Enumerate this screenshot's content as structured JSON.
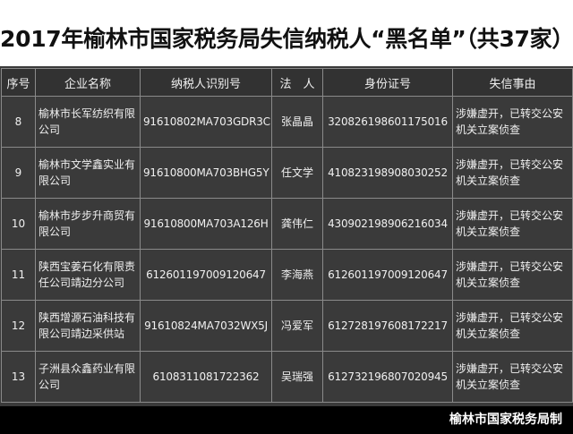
{
  "title": "2017年榆林市国家税务局失信纳税人“黑名单”（共37家）",
  "headers": [
    "序号",
    "企业名称",
    "纳税人识别号",
    "法　人",
    "身份证号",
    "失信事由"
  ],
  "rows": [
    {
      "no": "8",
      "name": "榆林市长军纺织有限公司",
      "tax_id": "91610802MA703GDR3C",
      "rep": "张晶晶",
      "id_no": "320826198601175016",
      "reason": "涉嫌虚开，已转交公安机关立案侦查"
    },
    {
      "no": "9",
      "name": "榆林市文学鑫实业有限公司",
      "tax_id": "91610800MA703BHG5Y",
      "rep": "任文学",
      "id_no": "410823198908030252",
      "reason": "涉嫌虚开，已转交公安机关立案侦查"
    },
    {
      "no": "10",
      "name": "榆林市步步升商贸有限公司",
      "tax_id": "91610800MA703A126H",
      "rep": "龚伟仁",
      "id_no": "430902198906216034",
      "reason": "涉嫌虚开，已转交公安机关立案侦查"
    },
    {
      "no": "11",
      "name": "陕西宝姜石化有限责任公司靖边分公司",
      "tax_id": "612601197009120647",
      "rep": "李海燕",
      "id_no": "612601197009120647",
      "reason": "涉嫌虚开，已转交公安机关立案侦查"
    },
    {
      "no": "12",
      "name": "陕西增源石油科技有限公司靖边采供站",
      "tax_id": "91610824MA7032WX5J",
      "rep": "冯爱军",
      "id_no": "612728197608172217",
      "reason": "涉嫌虚开，已转交公安机关立案侦查"
    },
    {
      "no": "13",
      "name": "子洲县众鑫药业有限公司",
      "tax_id": "610831108172236​2",
      "rep": "吴瑞强",
      "id_no": "612732196807020945",
      "reason": "涉嫌虚开，已转交公安机关立案侦查"
    }
  ],
  "footer": "榆林市国家税务局制"
}
